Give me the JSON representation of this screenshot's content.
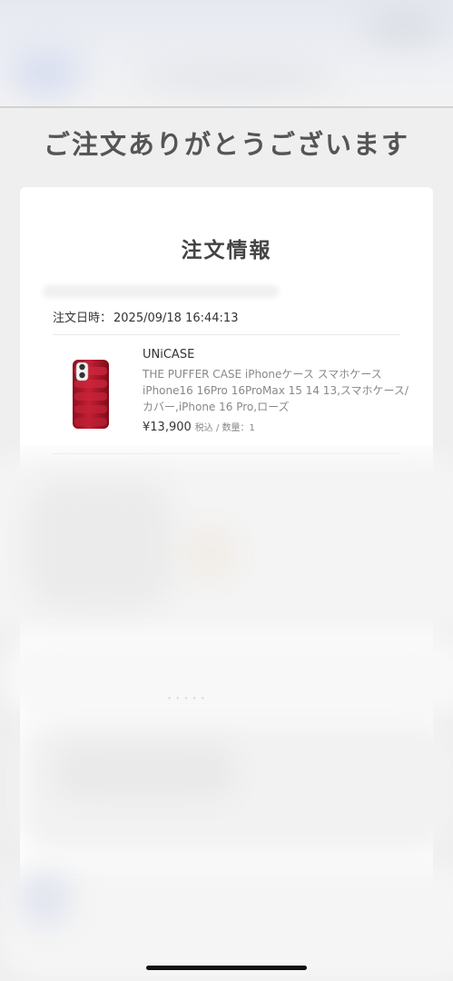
{
  "page": {
    "thanks_title": "ご注文ありがとうございます"
  },
  "order_card": {
    "title": "注文情報",
    "order_date_label": "注文日時：",
    "order_date_value": "2025/09/18 16:44:13",
    "item": {
      "brand": "UNiCASE",
      "name": "THE PUFFER CASE iPhoneケース スマホケース iPhone16 16Pro 16ProMax 15 14 13,スマホケース/カバー,iPhone 16 Pro,ローズ",
      "price": "¥13,900",
      "tax_qty": "税込 / 数量：1",
      "image_icon": "phone-case-image"
    }
  },
  "colors": {
    "background": "#efefef",
    "card": "#ffffff",
    "case_red": "#b8162c"
  }
}
